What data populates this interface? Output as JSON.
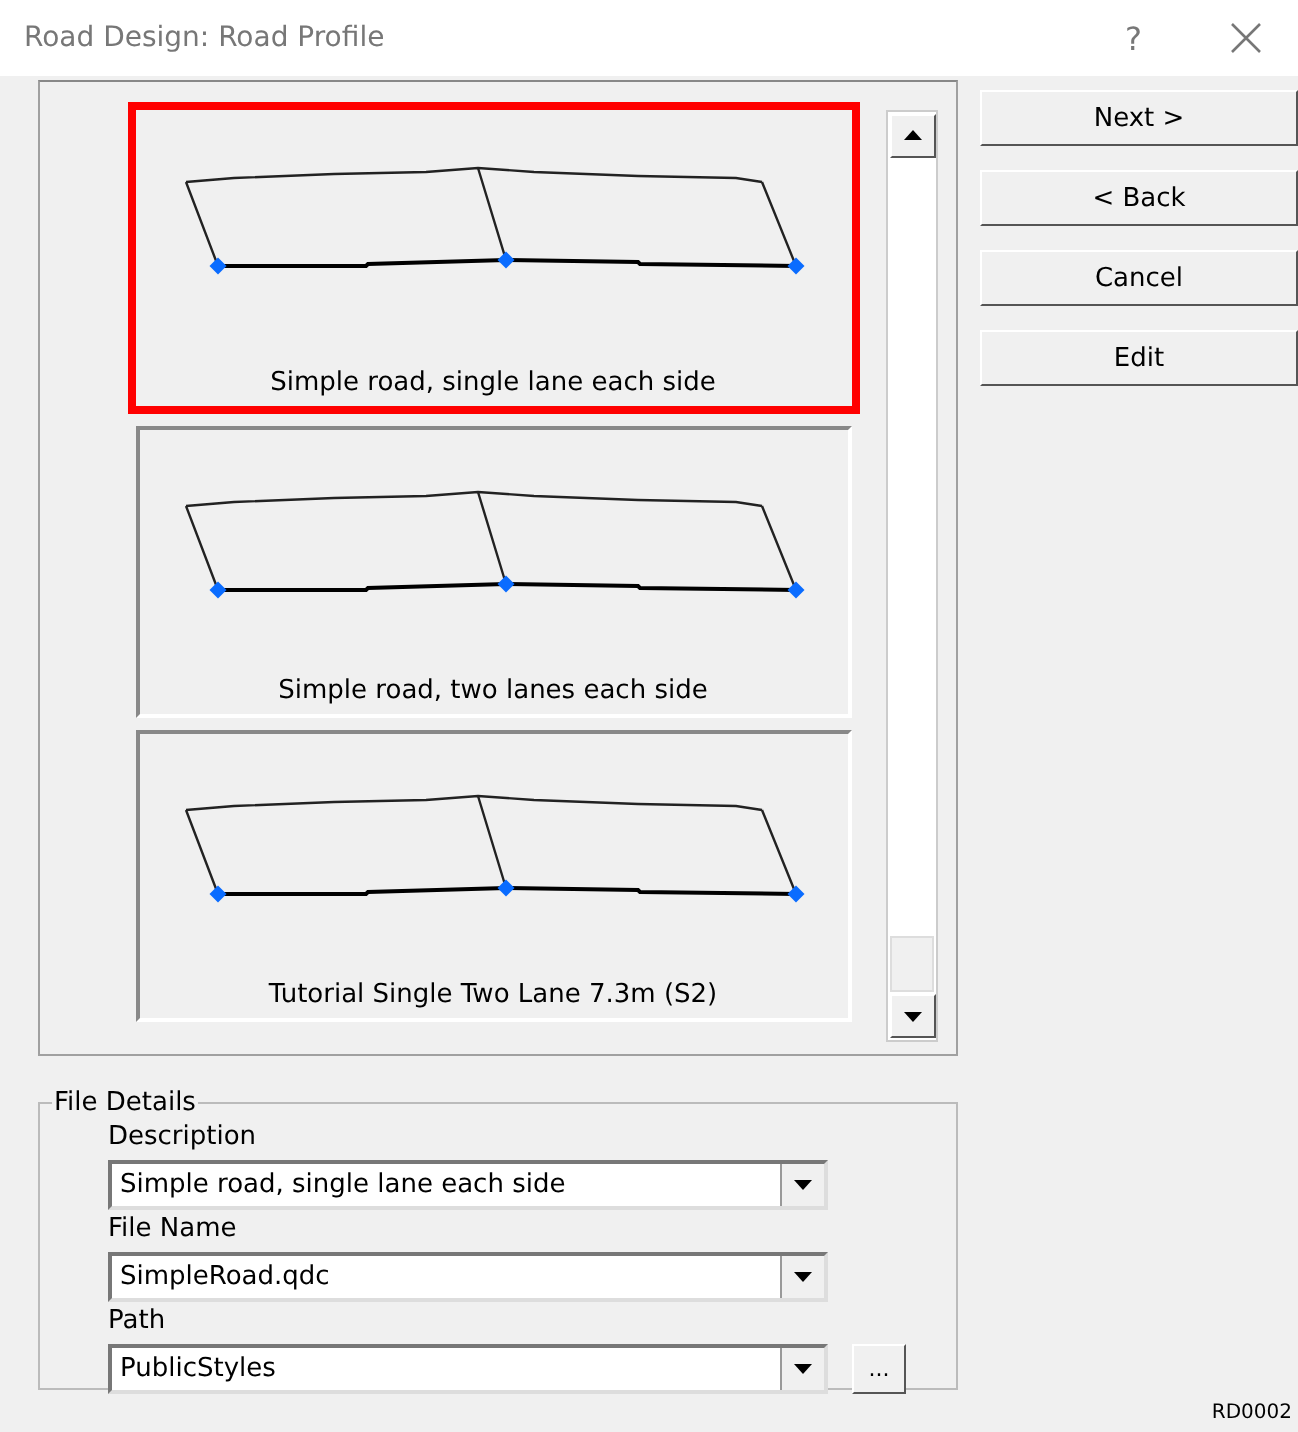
{
  "window": {
    "title": "Road Design: Road Profile",
    "help": "?"
  },
  "profiles": [
    {
      "caption": "Simple road, single lane each side",
      "selected": true
    },
    {
      "caption": "Simple road, two lanes each side",
      "selected": false
    },
    {
      "caption": "Tutorial Single Two Lane 7.3m (S2)",
      "selected": false
    }
  ],
  "buttons": [
    "Next >",
    "< Back",
    "Cancel",
    "Edit"
  ],
  "file_details": {
    "title": "File Details",
    "fields": [
      {
        "label": "Description",
        "value": "Simple road, single lane each side",
        "browse": false
      },
      {
        "label": "File Name",
        "value": "SimpleRoad.qdc",
        "browse": false
      },
      {
        "label": "Path",
        "value": "PublicStyles",
        "browse": true
      }
    ],
    "browse_label": "..."
  },
  "code": "RD0002"
}
